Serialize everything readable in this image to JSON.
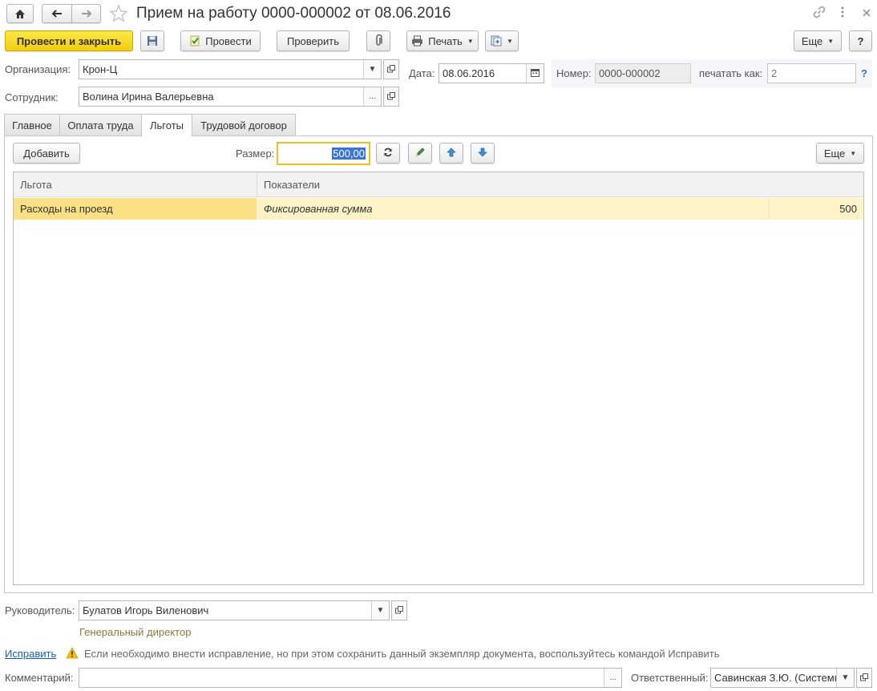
{
  "window": {
    "title": "Прием на работу 0000-000002 от 08.06.2016"
  },
  "toolbar": {
    "post_close": "Провести и закрыть",
    "post": "Провести",
    "check": "Проверить",
    "print": "Печать",
    "more": "Еще",
    "help": "?"
  },
  "form": {
    "org_label": "Организация:",
    "org_value": "Крон-Ц",
    "date_label": "Дата:",
    "date_value": "08.06.2016",
    "number_label": "Номер:",
    "number_value": "0000-000002",
    "print_as_label": "печатать как:",
    "print_as_placeholder": "2",
    "print_as_help": "?",
    "employee_label": "Сотрудник:",
    "employee_value": "Волина Ирина Валерьевна"
  },
  "tabs": [
    {
      "label": "Главное"
    },
    {
      "label": "Оплата труда"
    },
    {
      "label": "Льготы"
    },
    {
      "label": "Трудовой договор"
    }
  ],
  "benefits": {
    "add_button": "Добавить",
    "size_label": "Размер:",
    "size_value": "500,00",
    "more": "Еще",
    "columns": [
      "Льгота",
      "Показатели"
    ],
    "rows": [
      {
        "benefit": "Расходы на проезд",
        "indicator": "Фиксированная сумма",
        "amount": "500"
      }
    ]
  },
  "footer": {
    "manager_label": "Руководитель:",
    "manager_value": "Булатов Игорь Виленович",
    "manager_position": "Генеральный директор",
    "fix_link": "Исправить",
    "fix_hint": "Если необходимо внести исправление, но при этом сохранить данный экземпляр документа, воспользуйтесь командой Исправить",
    "comment_label": "Комментарий:",
    "comment_value": "",
    "responsible_label": "Ответственный:",
    "responsible_value": "Савинская З.Ю. (Системн"
  },
  "colors": {
    "primary_button": "#f2cd10",
    "selected_row": "#fdf3c7",
    "selected_cell": "#fbdf84",
    "active_field_border": "#f0c020",
    "link": "#1a5fb4",
    "warning": "#e8b600"
  },
  "icons": [
    "home-icon",
    "back-arrow-icon",
    "forward-arrow-icon",
    "star-icon",
    "link-icon",
    "kebab-icon",
    "close-icon",
    "save-icon",
    "post-icon",
    "paperclip-icon",
    "printer-icon",
    "related-docs-icon",
    "refresh-icon",
    "pencil-icon",
    "arrow-up-icon",
    "arrow-down-icon",
    "warning-icon",
    "calendar-icon",
    "open-icon"
  ]
}
